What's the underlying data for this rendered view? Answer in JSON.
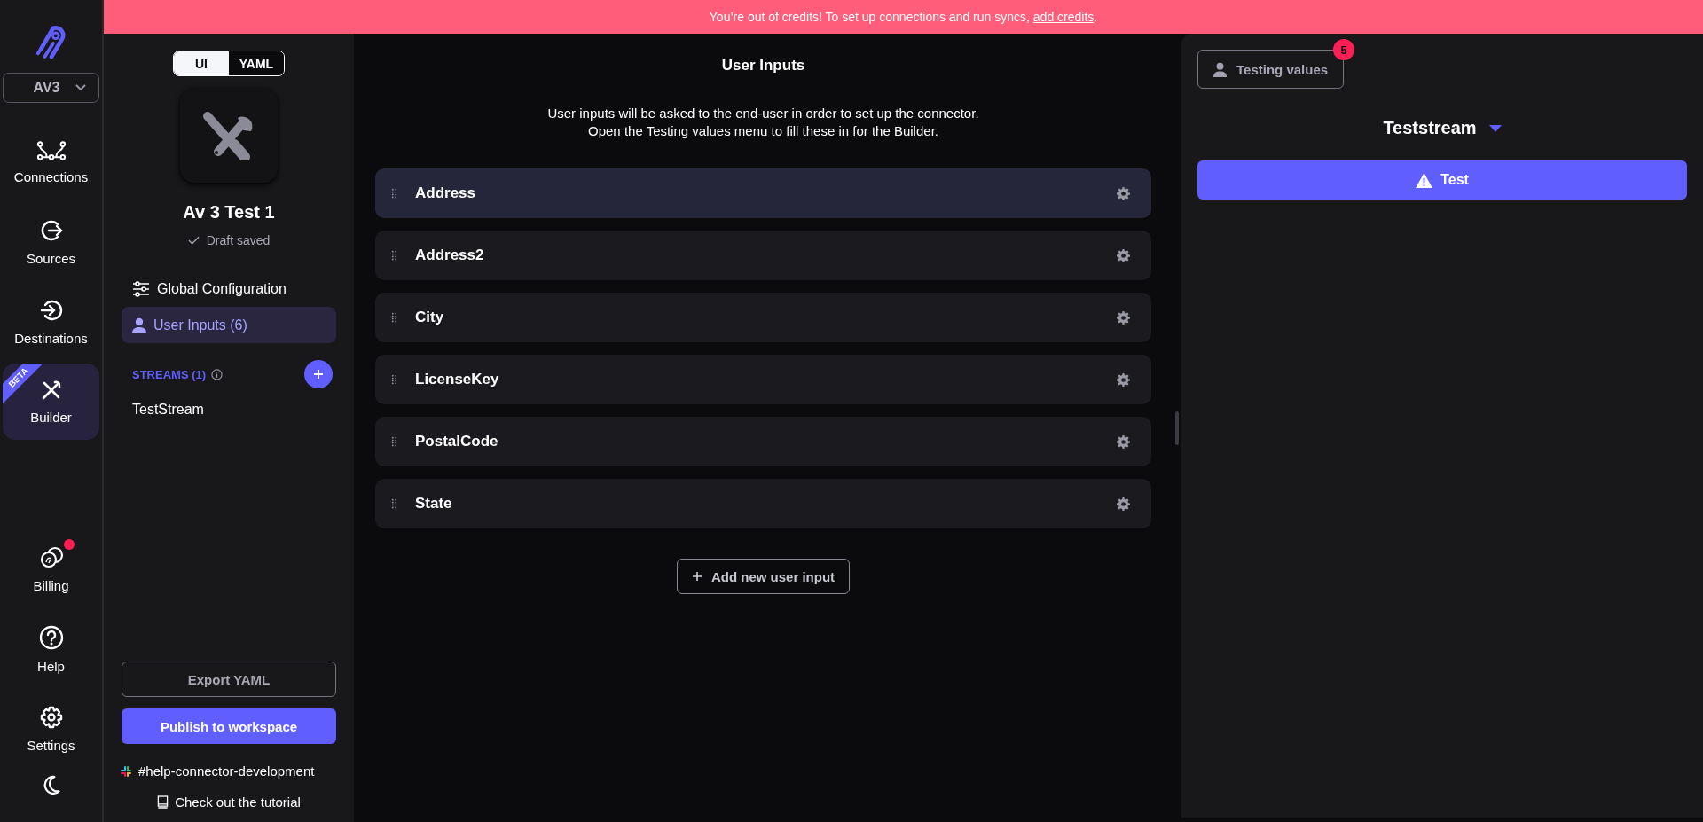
{
  "banner": {
    "text": "You’re out of credits! To set up connections and run syncs, ",
    "link": "add credits",
    "end": "."
  },
  "workspace": {
    "value": "AV3"
  },
  "nav": [
    {
      "kind": "connections",
      "label": "Connections",
      "selected": false
    },
    {
      "kind": "sources",
      "label": "Sources",
      "selected": false
    },
    {
      "kind": "destinations",
      "label": "Destinations",
      "selected": false
    },
    {
      "kind": "builder",
      "label": "Builder",
      "selected": true,
      "badge": "BETA"
    }
  ],
  "nav_bottom": [
    {
      "kind": "billing",
      "label": "Billing",
      "notification": true
    },
    {
      "kind": "help",
      "label": "Help",
      "notification": false
    },
    {
      "kind": "settings",
      "label": "Settings",
      "notification": false
    }
  ],
  "mode_toggle": [
    {
      "label": "UI",
      "selected": true
    },
    {
      "label": "YAML",
      "selected": false
    }
  ],
  "connector": {
    "name": "Av 3 Test 1",
    "status": "Draft saved"
  },
  "sidebar_items": [
    {
      "kind": "config",
      "label": "Global Configuration",
      "selected": false
    },
    {
      "kind": "user",
      "label": "User Inputs (6)",
      "selected": true
    }
  ],
  "streams": {
    "heading": "STREAMS (1)",
    "items": [
      {
        "label": "TestStream",
        "selected": false
      }
    ]
  },
  "sidebar_buttons": {
    "export": "Export YAML",
    "publish": "Publish to workspace"
  },
  "links": {
    "slack": "#help-connector-development",
    "tutorial": "Check out the tutorial"
  },
  "main": {
    "title": "User Inputs",
    "description": [
      "User inputs will be asked to the end-user in order to set up the connector.",
      "Open the Testing values menu to fill these in for the Builder."
    ],
    "inputs": [
      {
        "label": "Address",
        "hovered": true
      },
      {
        "label": "Address2",
        "hovered": false
      },
      {
        "label": "City",
        "hovered": false
      },
      {
        "label": "LicenseKey",
        "hovered": false
      },
      {
        "label": "PostalCode",
        "hovered": false
      },
      {
        "label": "State",
        "hovered": false
      }
    ],
    "add_button": "Add new user input"
  },
  "test_panel": {
    "testing_values": "Testing values",
    "badge": "5",
    "stream": "Teststream",
    "test_button": "Test"
  }
}
